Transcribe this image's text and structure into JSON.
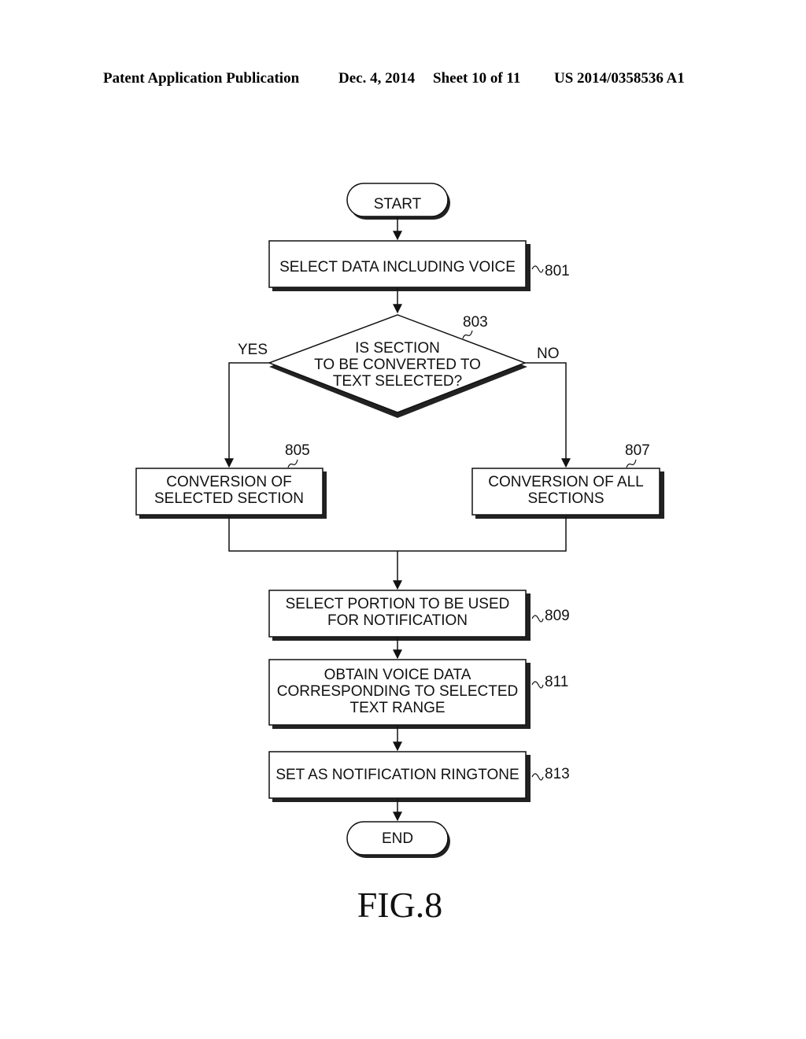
{
  "header": {
    "publication": "Patent Application Publication",
    "date": "Dec. 4, 2014",
    "sheet": "Sheet 10 of 11",
    "number": "US 2014/0358536 A1"
  },
  "flowchart": {
    "start": "START",
    "end": "END",
    "steps": {
      "s801": {
        "ref": "801",
        "lines": [
          "SELECT DATA INCLUDING VOICE"
        ]
      },
      "s803": {
        "ref": "803",
        "lines": [
          "IS SECTION",
          "TO BE CONVERTED TO",
          "TEXT SELECTED?"
        ]
      },
      "s805": {
        "ref": "805",
        "lines": [
          "CONVERSION OF",
          "SELECTED SECTION"
        ]
      },
      "s807": {
        "ref": "807",
        "lines": [
          "CONVERSION OF ALL",
          "SECTIONS"
        ]
      },
      "s809": {
        "ref": "809",
        "lines": [
          "SELECT PORTION TO BE USED",
          "FOR NOTIFICATION"
        ]
      },
      "s811": {
        "ref": "811",
        "lines": [
          "OBTAIN VOICE DATA",
          "CORRESPONDING TO SELECTED",
          "TEXT RANGE"
        ]
      },
      "s813": {
        "ref": "813",
        "lines": [
          "SET AS NOTIFICATION RINGTONE"
        ]
      }
    },
    "branches": {
      "yes": "YES",
      "no": "NO"
    }
  },
  "figure_label": "FIG.8"
}
